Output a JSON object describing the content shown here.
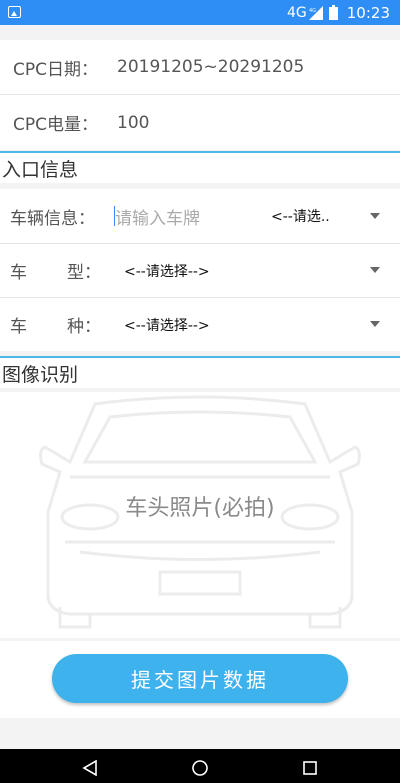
{
  "status_bar": {
    "network": "4G",
    "network_small": "4G",
    "time": "10:23"
  },
  "cpc": {
    "date_label": "CPC日期：",
    "date_value": "20191205~20291205",
    "battery_label": "CPC电量：",
    "battery_value": "100"
  },
  "entry_section": {
    "title": "入口信息",
    "vehicle_label": "车辆信息：",
    "plate_placeholder": "请输入车牌",
    "plate_select": "<--请选..",
    "type_label_1": "车",
    "type_label_2": "型：",
    "type_select": "<--请选择-->",
    "kind_label_1": "车",
    "kind_label_2": "种：",
    "kind_select": "<--请选择-->"
  },
  "image_section": {
    "title": "图像识别",
    "photo_label": "车头照片(必拍)"
  },
  "submit_label": "提交图片数据",
  "colors": {
    "status_bar": "#2f8ef5",
    "accent": "#3eb2ec",
    "section_border": "#4fb6e8"
  }
}
